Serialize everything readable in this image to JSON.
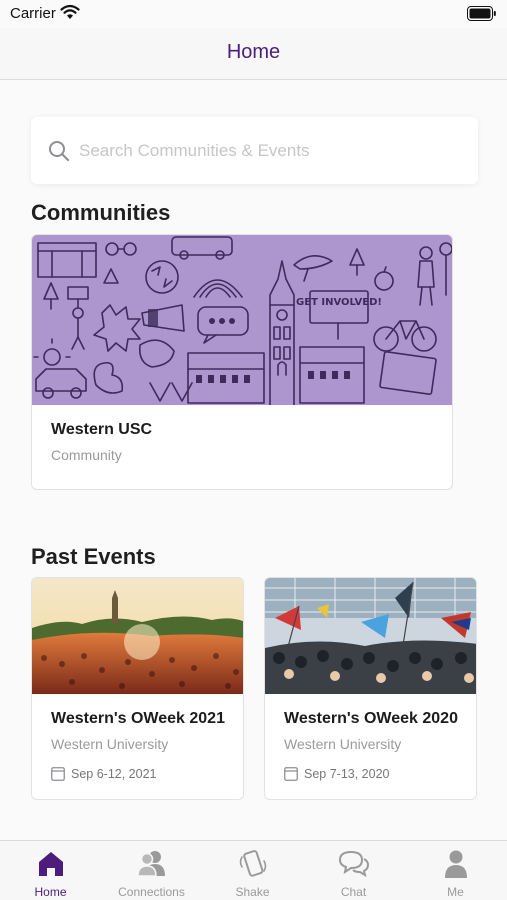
{
  "status_bar": {
    "carrier": "Carrier"
  },
  "nav": {
    "title": "Home"
  },
  "search": {
    "placeholder": "Search Communities & Events"
  },
  "communities": {
    "title": "Communities",
    "items": [
      {
        "name": "Western USC",
        "type": "Community",
        "banner_text": "GET INVOLVED!"
      }
    ]
  },
  "past_events": {
    "title": "Past Events",
    "items": [
      {
        "title": "Western's OWeek 2021",
        "organizer": "Western University",
        "date": "Sep 6-12, 2021"
      },
      {
        "title": "Western's OWeek 2020",
        "organizer": "Western University",
        "date": "Sep 7-13, 2020"
      }
    ]
  },
  "tab_bar": {
    "items": [
      {
        "label": "Home",
        "icon": "home-icon",
        "active": true
      },
      {
        "label": "Connections",
        "icon": "connections-icon",
        "active": false
      },
      {
        "label": "Shake",
        "icon": "shake-icon",
        "active": false
      },
      {
        "label": "Chat",
        "icon": "chat-icon",
        "active": false
      },
      {
        "label": "Me",
        "icon": "profile-icon",
        "active": false
      }
    ]
  },
  "colors": {
    "accent": "#4d1d7d",
    "banner_purple": "#ad96cd",
    "inactive": "#9a9a9a",
    "placeholder": "#c6c6c8"
  }
}
